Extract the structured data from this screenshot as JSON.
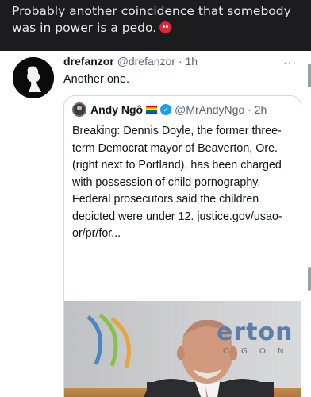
{
  "caption": {
    "text": "Probably another coincidence that somebody was in power is a pedo.",
    "emoji": "angry-face"
  },
  "tweet": {
    "display_name": "drefanzor",
    "handle": "@drefanzor",
    "separator": "·",
    "time": "1h",
    "text": "Another one.",
    "more_icon": "more-horizontal-icon"
  },
  "quoted_tweet": {
    "display_name": "Andy Ngô",
    "handle": "@MrAndyNgo",
    "separator": "·",
    "time": "2h",
    "badges": [
      "rainbow-flag-icon",
      "verified-icon"
    ],
    "text": "Breaking: Dennis Doyle, the former three-term Democrat mayor of Beaverton, Ore. (right next to Portland), has been charged with possession of child pornography. Federal prosecutors said the children depicted were under 12. justice.gov/usao-or/pr/for...",
    "image": {
      "sign_word": "erton",
      "sign_sub": "O  G  O  N"
    }
  }
}
